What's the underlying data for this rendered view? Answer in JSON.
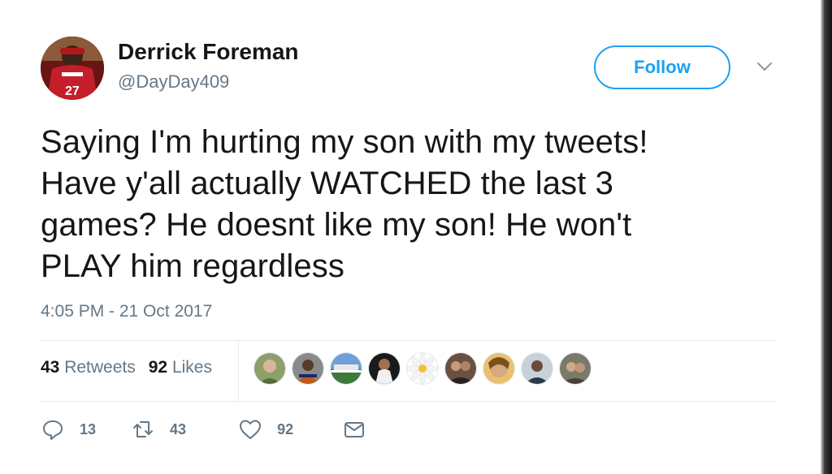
{
  "author": {
    "name": "Derrick Foreman",
    "handle": "@DayDay409"
  },
  "follow_label": "Follow",
  "tweet": {
    "lines": [
      "Saying I'm hurting my son with my tweets!",
      "Have y'all actually WATCHED the last 3",
      "games? He doesnt like my son! He won't",
      "PLAY him regardless"
    ],
    "timestamp": "4:05 PM - 21 Oct 2017"
  },
  "stats": {
    "retweets_count": "43",
    "retweets_label": "Retweets",
    "likes_count": "92",
    "likes_label": "Likes"
  },
  "actions": {
    "reply_count": "13",
    "retweet_count": "43",
    "like_count": "92"
  },
  "icons": [
    "reply-icon",
    "retweet-icon",
    "heart-icon",
    "direct-message-icon",
    "chevron-down-icon"
  ],
  "colors": {
    "accent": "#1da1f2",
    "text": "#14171a",
    "muted": "#657786",
    "divider": "#e6ecf0"
  },
  "liker_avatars_count": 9
}
